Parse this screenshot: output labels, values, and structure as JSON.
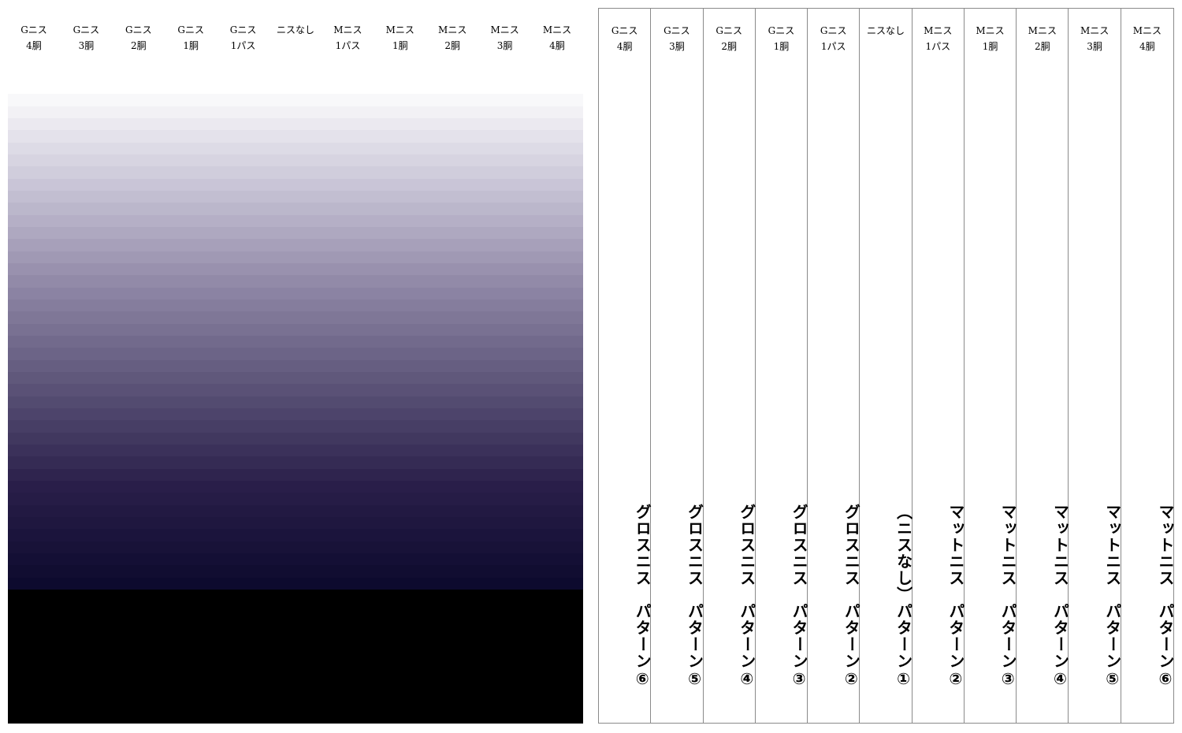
{
  "left_sheet": {
    "headers": [
      {
        "line1": "Gニス",
        "line2": "4胴"
      },
      {
        "line1": "Gニス",
        "line2": "3胴"
      },
      {
        "line1": "Gニス",
        "line2": "2胴"
      },
      {
        "line1": "Gニス",
        "line2": "1胴"
      },
      {
        "line1": "Gニス",
        "line2": "1パス"
      },
      {
        "line1": "ニスなし",
        "line2": ""
      },
      {
        "line1": "Mニス",
        "line2": "1パス"
      },
      {
        "line1": "Mニス",
        "line2": "1胴"
      },
      {
        "line1": "Mニス",
        "line2": "2胴"
      },
      {
        "line1": "Mニス",
        "line2": "3胴"
      },
      {
        "line1": "Mニス",
        "line2": "4胴"
      }
    ],
    "gradient_colors": [
      "#ffffff",
      "#c8c4d6",
      "#8f87a6",
      "#5c5478",
      "#2a1f4a",
      "#0d0a2e",
      "#000000"
    ]
  },
  "right_sheet": {
    "columns": [
      {
        "line1": "Gニス",
        "line2": "4胴",
        "label": "グロスニス　パターン⑥"
      },
      {
        "line1": "Gニス",
        "line2": "3胴",
        "label": "グロスニス　パターン⑤"
      },
      {
        "line1": "Gニス",
        "line2": "2胴",
        "label": "グロスニス　パターン④"
      },
      {
        "line1": "Gニス",
        "line2": "1胴",
        "label": "グロスニス　パターン③"
      },
      {
        "line1": "Gニス",
        "line2": "1パス",
        "label": "グロスニス　パターン②"
      },
      {
        "line1": "ニスなし",
        "line2": "",
        "label": "（ニスなし）パターン①"
      },
      {
        "line1": "Mニス",
        "line2": "1パス",
        "label": "マットニス　パターン②"
      },
      {
        "line1": "Mニス",
        "line2": "1胴",
        "label": "マットニス　パターン③"
      },
      {
        "line1": "Mニス",
        "line2": "2胴",
        "label": "マットニス　パターン④"
      },
      {
        "line1": "Mニス",
        "line2": "3胴",
        "label": "マットニス　パターン⑤"
      },
      {
        "line1": "Mニス",
        "line2": "4胴",
        "label": "マットニス　パターン⑥"
      }
    ]
  }
}
